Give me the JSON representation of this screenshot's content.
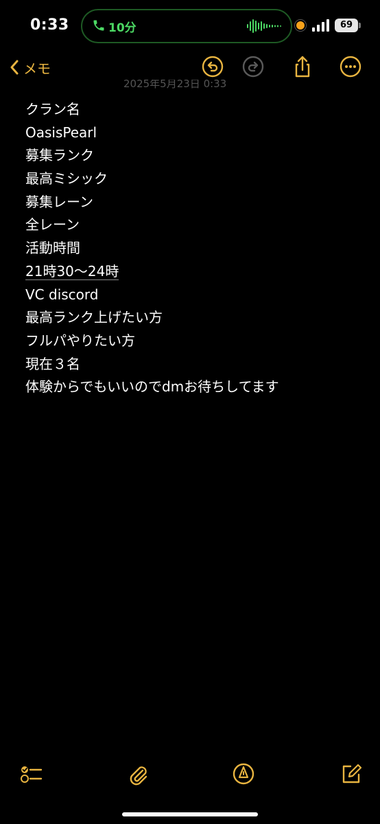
{
  "status": {
    "time": "0:33",
    "call_duration": "10分",
    "battery": "69"
  },
  "nav": {
    "back_label": "メモ"
  },
  "note": {
    "date": "2025年5月23日 0:33",
    "lines": [
      "クラン名",
      "OasisPearl",
      "募集ランク",
      "最高ミシック",
      "募集レーン",
      "全レーン",
      "活動時間",
      "21時30～24時",
      "VC discord",
      "最高ランク上げたい方",
      "フルパやりたい方",
      "現在３名",
      "体験からでもいいのでdmお待ちしてます"
    ]
  },
  "colors": {
    "accent": "#e8b440",
    "call_green": "#4cd964",
    "background": "#000000"
  },
  "icons": [
    "chevron-left-icon",
    "undo-icon",
    "redo-icon",
    "share-icon",
    "more-icon",
    "checklist-icon",
    "paperclip-icon",
    "markup-pen-icon",
    "compose-icon"
  ]
}
